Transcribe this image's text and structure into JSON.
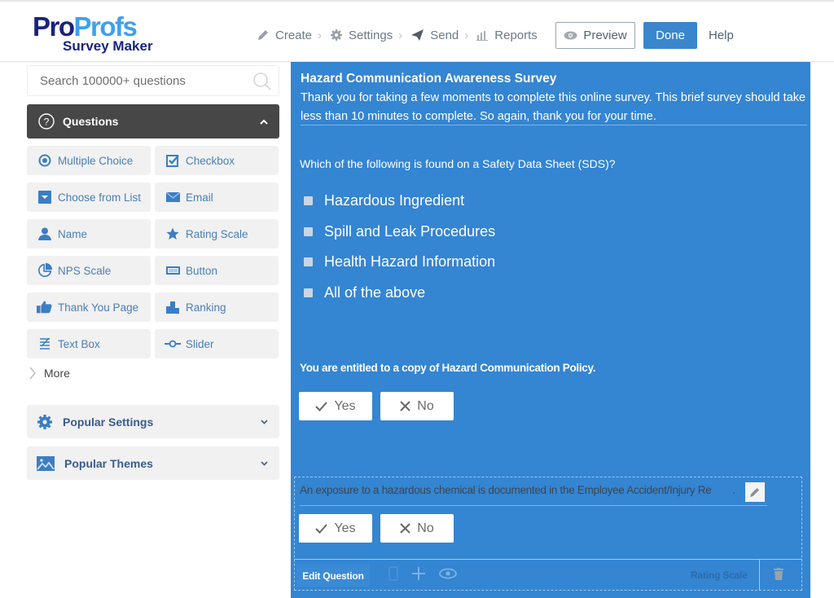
{
  "header": {
    "logo": {
      "brand_part1": "Pro",
      "brand_part2": "Profs",
      "subtitle": "Survey Maker"
    },
    "nav": [
      {
        "label": "Create",
        "icon": "pencil-icon"
      },
      {
        "label": "Settings",
        "icon": "gear-icon"
      },
      {
        "label": "Send",
        "icon": "paper-plane-icon"
      },
      {
        "label": "Reports",
        "icon": "bar-chart-icon"
      }
    ],
    "preview_label": "Preview",
    "done_label": "Done",
    "help_label": "Help"
  },
  "sidebar": {
    "search": {
      "placeholder": "Search 100000+ questions",
      "value": ""
    },
    "questions_header": "Questions",
    "question_types": [
      {
        "label": "Multiple Choice",
        "icon": "radio-icon"
      },
      {
        "label": "Checkbox",
        "icon": "checkbox-icon"
      },
      {
        "label": "Choose from List",
        "icon": "dropdown-icon"
      },
      {
        "label": "Email",
        "icon": "envelope-icon"
      },
      {
        "label": "Name",
        "icon": "user-icon"
      },
      {
        "label": "Rating Scale",
        "icon": "star-icon"
      },
      {
        "label": "NPS Scale",
        "icon": "pie-icon"
      },
      {
        "label": "Button",
        "icon": "button-icon"
      },
      {
        "label": "Thank You Page",
        "icon": "thumbs-up-icon"
      },
      {
        "label": "Ranking",
        "icon": "ranking-icon"
      },
      {
        "label": "Text Box",
        "icon": "text-box-icon"
      },
      {
        "label": "Slider",
        "icon": "slider-icon"
      }
    ],
    "more_label": "More",
    "popular_settings": "Popular Settings",
    "popular_themes": "Popular Themes"
  },
  "survey": {
    "title": "Hazard Communication Awareness Survey",
    "description": "Thank you for taking a few moments to complete this online survey.  This brief survey should take less than 10 minutes to complete.  So again, thank you for your time.",
    "questions": [
      {
        "text": "Which of the following is found on a Safety Data Sheet (SDS)?",
        "options": [
          "Hazardous Ingredient",
          "Spill and Leak Procedures",
          "Health Hazard Information",
          "All of the above"
        ]
      },
      {
        "text": "You are entitled to a copy of Hazard Communication Policy.",
        "yes_label": "Yes",
        "no_label": "No"
      },
      {
        "text": "An exposure to a hazardous chemical is documented in the Employee Accident/Injury Re",
        "text_tail": ".",
        "yes_label": "Yes",
        "no_label": "No"
      }
    ],
    "toolbar": {
      "edit_label": "Edit Question",
      "type_label": "Rating Scale"
    }
  },
  "colors": {
    "accent": "#3485d2",
    "done_button": "#3a86cc",
    "brand_dark": "#1a237e",
    "brand_light": "#3ea0f0",
    "header_dark": "#474747"
  }
}
